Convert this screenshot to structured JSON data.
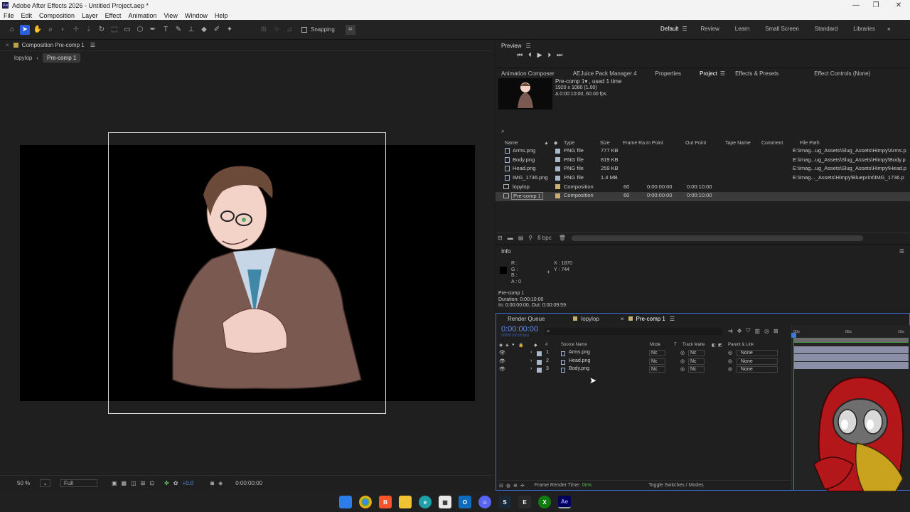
{
  "window": {
    "title": "Adobe After Effects 2026 - Untitled Project.aep *",
    "app_badge": "Ae",
    "controls": [
      "—",
      "❐",
      "✕"
    ]
  },
  "menu": [
    "File",
    "Edit",
    "Composition",
    "Layer",
    "Effect",
    "Animation",
    "View",
    "Window",
    "Help"
  ],
  "toolbar": {
    "snapping_label": "Snapping",
    "workspaces": [
      "Default",
      "Review",
      "Learn",
      "Small Screen",
      "Standard",
      "Libraries"
    ],
    "current_workspace": "Default"
  },
  "comp_panel": {
    "title": "Composition Pre-comp 1",
    "breadcrumbs": [
      "lopylop",
      "Pre-comp 1"
    ],
    "zoom": "50 %",
    "resolution": "Full",
    "exposure": "+0.0",
    "timecode": "0:00:00:00"
  },
  "preview": {
    "title": "Preview"
  },
  "project_panel": {
    "tabs": [
      "Animation Composer",
      "AEJuice Pack Manager 4",
      "Properties",
      "Project",
      "Effects & Presets",
      "Effect Controls (None)"
    ],
    "current_tab": "Project",
    "selected_info": {
      "name": "Pre-comp 1▾ , used 1 time",
      "size": "1920 x 1080 (1.00)",
      "duration": "Δ 0:00:10:00, 60.00 fps"
    },
    "columns": [
      "Name",
      "Type",
      "Size",
      "Frame Ra...",
      "In Point",
      "Out Point",
      "Tape Name",
      "Comment",
      "File Path"
    ],
    "rows": [
      {
        "name": "Arms.png",
        "type": "PNG file",
        "size": "777 KB",
        "fps": "",
        "in": "",
        "out": "",
        "path": "E:\\imag...ug_Assets\\Slug_Assets\\Himpy\\Arms.p",
        "kind": "file"
      },
      {
        "name": "Body.png",
        "type": "PNG file",
        "size": "819 KB",
        "fps": "",
        "in": "",
        "out": "",
        "path": "E:\\imag...ug_Assets\\Slug_Assets\\Himpy\\Body.p",
        "kind": "file"
      },
      {
        "name": "Head.png",
        "type": "PNG file",
        "size": "259 KB",
        "fps": "",
        "in": "",
        "out": "",
        "path": "E:\\imag...ug_Assets\\Slug_Assets\\Himpy\\Head.p",
        "kind": "file"
      },
      {
        "name": "IMG_1736.png",
        "type": "PNG file",
        "size": "1.4 MB",
        "fps": "",
        "in": "",
        "out": "",
        "path": "E:\\imag..._Assets\\Himpy\\Blueprint\\IMG_1736.p",
        "kind": "file"
      },
      {
        "name": "lopylop",
        "type": "Composition",
        "size": "",
        "fps": "60",
        "in": "0:00:00:00",
        "out": "0:00:10:00",
        "path": "",
        "kind": "comp"
      },
      {
        "name": "Pre-comp 1",
        "type": "Composition",
        "size": "",
        "fps": "60",
        "in": "0:00:00:00",
        "out": "0:00:10:00",
        "path": "",
        "kind": "comp"
      }
    ],
    "bpc": "8 bpc"
  },
  "info_panel": {
    "title": "Info",
    "r": "R :",
    "g": "G :",
    "b": "B :",
    "a": "A : 0",
    "x": "X : 1870",
    "y": "Y : 744",
    "comp_name": "Pre-comp 1",
    "duration": "Duration: 0:00:10:00",
    "in_out": "In: 0:00:00:00, Out: 0:00:09:59"
  },
  "timeline": {
    "tabs": [
      "Render Queue",
      "lopylop",
      "Pre-comp 1"
    ],
    "current_tab": "Pre-comp 1",
    "timecode": "0:00:00:00",
    "fps_label": "00000 (60.00 fps)",
    "col_source": "Source Name",
    "col_mode": "Mode",
    "col_t": "T",
    "col_matte": "Track Matte",
    "col_parent": "Parent & Link",
    "ruler": [
      "00s",
      "05s",
      "10s"
    ],
    "layers": [
      {
        "num": "1",
        "name": "Arms.png",
        "mode": "Nc",
        "matte": "Nc",
        "parent": "None"
      },
      {
        "num": "2",
        "name": "Head.png",
        "mode": "Nc",
        "matte": "Nc",
        "parent": "None"
      },
      {
        "num": "3",
        "name": "Body.png",
        "mode": "Nc",
        "matte": "Nc",
        "parent": "None"
      }
    ],
    "frame_render_label": "Frame Render Time:",
    "frame_render_value": "0ms",
    "toggle_label": "Toggle Switches / Modes"
  },
  "taskbar": [
    "windows-start",
    "chrome",
    "brave",
    "files",
    "edge",
    "store",
    "outlook",
    "discord",
    "steam",
    "epic",
    "xbox",
    "after-effects"
  ]
}
